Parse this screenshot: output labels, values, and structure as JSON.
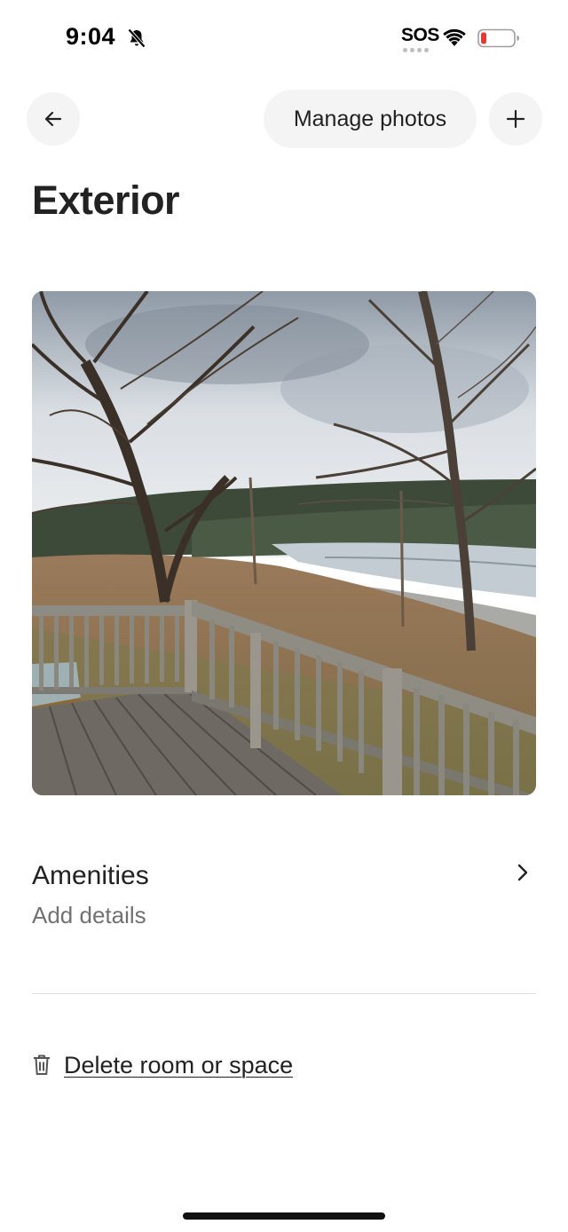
{
  "status_bar": {
    "time": "9:04",
    "sos_label": "SOS",
    "icons": [
      "bell-slash-icon",
      "wifi-icon",
      "battery-low-icon"
    ],
    "battery_color": "#e53935"
  },
  "header": {
    "back_icon": "arrow-left-icon",
    "manage_photos_label": "Manage photos",
    "add_icon": "plus-icon"
  },
  "page": {
    "title": "Exterior"
  },
  "photo": {
    "subject": "wooden deck overlooking trees, road and water"
  },
  "amenities": {
    "title": "Amenities",
    "subtitle": "Add details",
    "chevron_icon": "chevron-right-icon"
  },
  "delete": {
    "icon": "trash-icon",
    "label": "Delete room or space"
  },
  "colors": {
    "text_primary": "#222222",
    "text_secondary": "#717171",
    "button_bg": "#f4f4f4",
    "divider": "#dddddd"
  }
}
